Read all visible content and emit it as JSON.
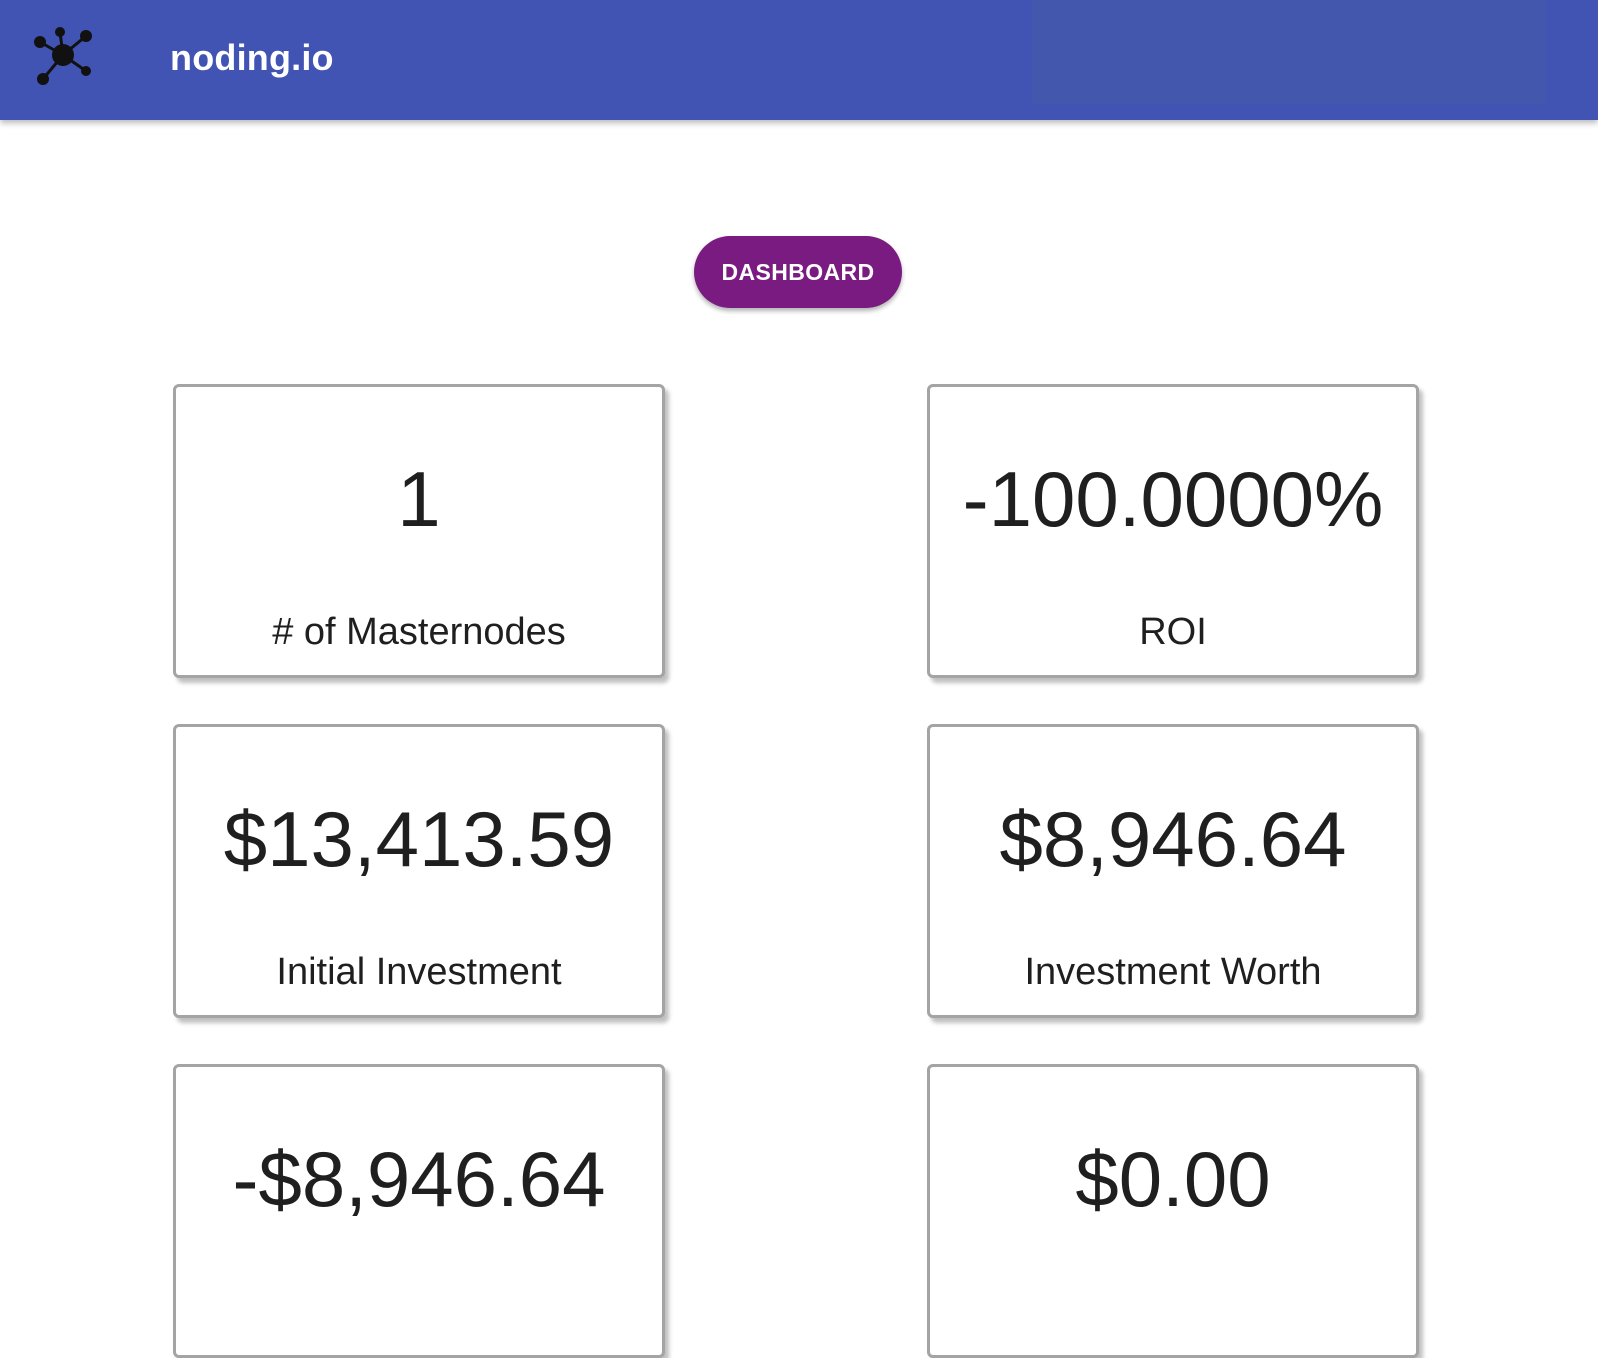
{
  "header": {
    "brand": "noding.io",
    "logo_icon": "network-nodes-icon",
    "bar_color": "#4153b3"
  },
  "nav": {
    "dashboard_label": "DASHBOARD",
    "button_color": "#7a1b81"
  },
  "stats": [
    {
      "value": "1",
      "label": "# of Masternodes"
    },
    {
      "value": "-100.0000%",
      "label": "ROI"
    },
    {
      "value": "$13,413.59",
      "label": "Initial Investment"
    },
    {
      "value": "$8,946.64",
      "label": "Investment Worth"
    },
    {
      "value": "-$8,946.64",
      "label": ""
    },
    {
      "value": "$0.00",
      "label": ""
    }
  ]
}
